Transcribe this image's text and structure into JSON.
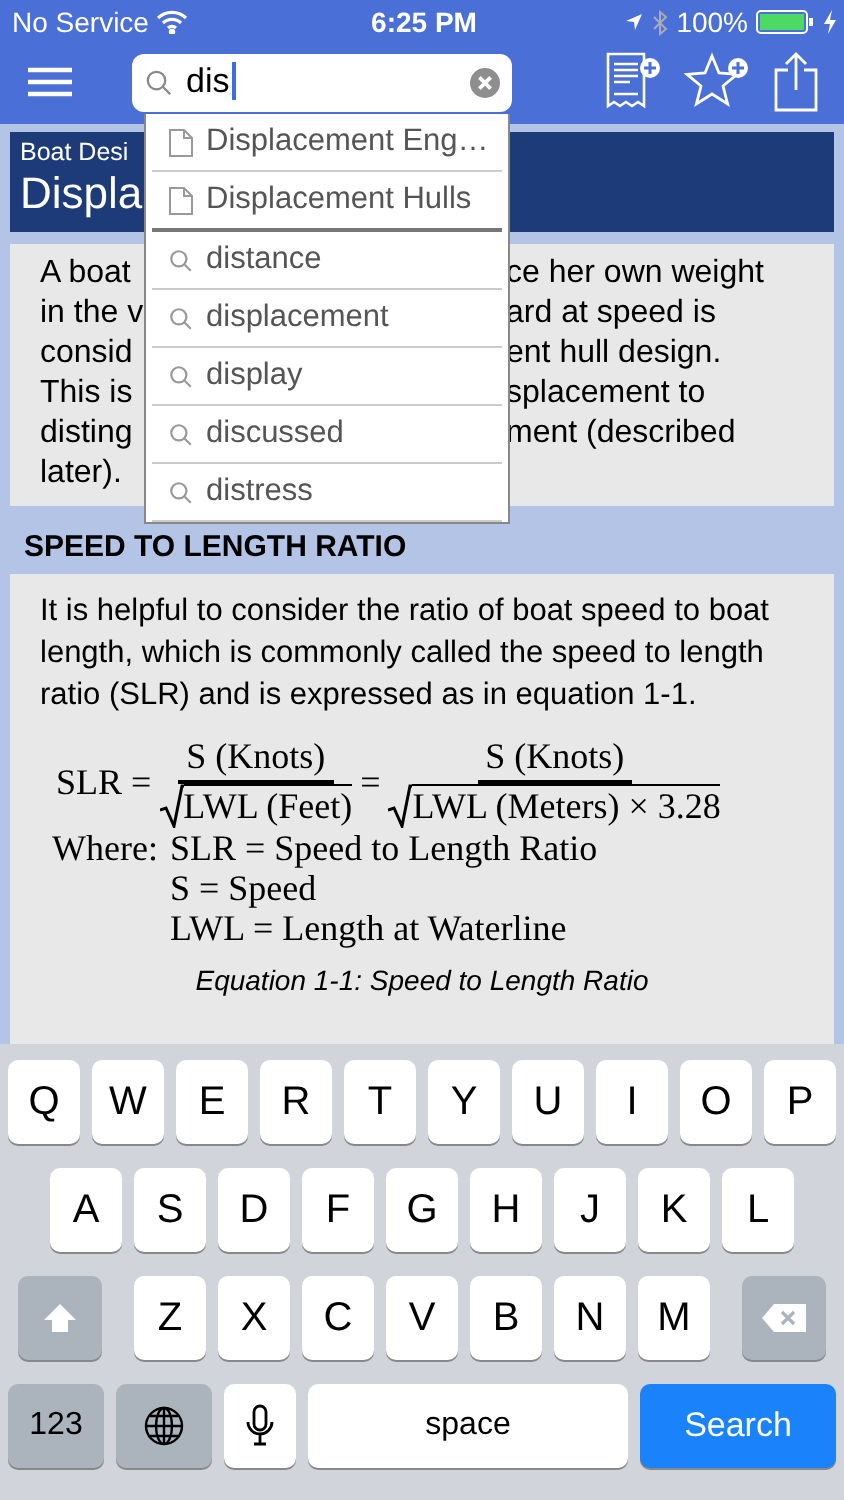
{
  "status_bar": {
    "carrier": "No Service",
    "time": "6:25 PM",
    "battery": "100%"
  },
  "nav_bar": {
    "search": {
      "value": "dis"
    }
  },
  "header": {
    "breadcrumb": "Boat Desi",
    "title": "Displa"
  },
  "intro_lines": [
    {
      "left": "A boat",
      "right": "ce her own weight"
    },
    {
      "left": "in the v",
      "right": "ard at speed is"
    },
    {
      "left": "consid",
      "right": "ent hull design."
    },
    {
      "left": "This is",
      "right": "splacement to"
    },
    {
      "left": "disting",
      "right": "ment (described"
    },
    {
      "left": "later)."
    }
  ],
  "suggestions": [
    {
      "kind": "page",
      "label": "Displacement Eng…"
    },
    {
      "kind": "page",
      "label": "Displacement Hulls"
    },
    {
      "kind": "term",
      "label": "distance"
    },
    {
      "kind": "term",
      "label": "displacement"
    },
    {
      "kind": "term",
      "label": "display"
    },
    {
      "kind": "term",
      "label": "discussed"
    },
    {
      "kind": "term",
      "label": "distress"
    }
  ],
  "section": {
    "heading": "SPEED TO LENGTH RATIO",
    "paragraph": "It is helpful to consider the ratio of boat speed to boat length, which is commonly called the speed to length ratio (SLR) and is expressed as in equation 1-1.",
    "equation": {
      "lhs": "SLR =",
      "fractions": [
        {
          "numerator": "S (Knots)",
          "denominator": "LWL (Feet)"
        },
        {
          "numerator": "S (Knots)",
          "denominator": "LWL (Meters) × 3.28"
        }
      ],
      "equals": "=",
      "where_label": "Where:",
      "definitions": [
        "SLR = Speed to Length Ratio",
        "S = Speed",
        "LWL = Length at Waterline"
      ]
    },
    "caption": "Equation 1-1: Speed to Length Ratio"
  },
  "keyboard": {
    "rows": [
      [
        "Q",
        "W",
        "E",
        "R",
        "T",
        "Y",
        "U",
        "I",
        "O",
        "P"
      ],
      [
        "A",
        "S",
        "D",
        "F",
        "G",
        "H",
        "J",
        "K",
        "L"
      ],
      [
        "Z",
        "X",
        "C",
        "V",
        "B",
        "N",
        "M"
      ]
    ],
    "numbers_key": "123",
    "space_key": "space",
    "search_key": "Search"
  }
}
